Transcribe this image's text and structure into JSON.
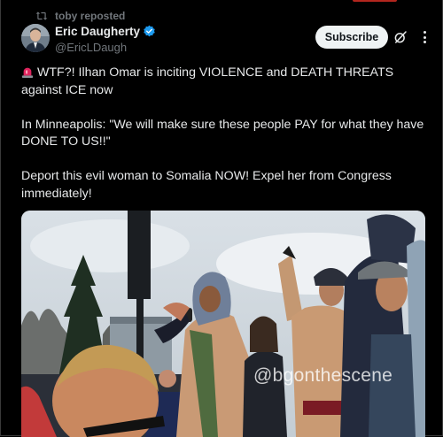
{
  "repost": {
    "label": "toby reposted"
  },
  "author": {
    "name": "Eric Daugherty",
    "handle": "@EricLDaugh"
  },
  "actions": {
    "subscribe_label": "Subscribe"
  },
  "tweet": {
    "paragraphs": [
      "WTF?! Ilhan Omar is inciting VIOLENCE and DEATH THREATS against ICE now",
      "In Minneapolis: \"We will make sure these people PAY for what they have DONE TO US!!\"",
      "Deport this evil woman to Somalia NOW! Expel her from Congress immediately!"
    ]
  },
  "media": {
    "watermark": "@bgonthescene"
  },
  "icons": {
    "repost": "repost-icon",
    "verified": "verified-badge-icon",
    "grok": "grok-icon",
    "more": "more-options-icon",
    "alarm": "police-light-emoji-icon"
  },
  "colors": {
    "background": "#000000",
    "text": "#e7e9ea",
    "muted": "#71767b",
    "verified": "#1d9bf0",
    "button": "#eff3f4"
  }
}
